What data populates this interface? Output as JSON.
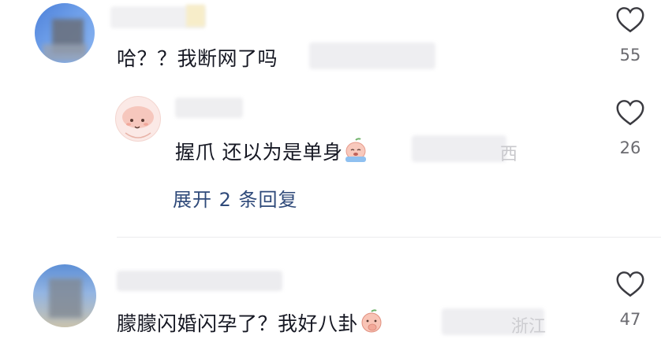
{
  "comments": [
    {
      "text": "哈？？我断网了吗",
      "likes": "55"
    },
    {
      "text": "握爪 还以为是单身",
      "likes": "26",
      "location_fragment": "西",
      "emoji": "crying-peach-emoji",
      "expand_label": "展开 2 条回复"
    },
    {
      "text": "朦朦闪婚闪孕了？我好八卦",
      "likes": "47",
      "location_fragment": "浙江",
      "emoji": "peach-hand-over-mouth-emoji"
    }
  ],
  "icons": {
    "like": "heart-outline-icon"
  },
  "colors": {
    "text": "#161823",
    "count": "#6b6b70",
    "link": "#2f4a7a",
    "divider": "#ececee"
  }
}
